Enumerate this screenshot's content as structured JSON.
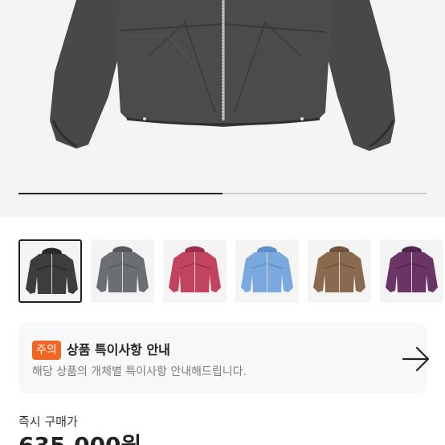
{
  "gallery": {
    "current_index": 0,
    "progress_fraction": 0.5,
    "thumbnails": [
      {
        "name": "charcoal",
        "color": "#3d3d3f",
        "shade": "#2a2a2c"
      },
      {
        "name": "grey",
        "color": "#6b6f73",
        "shade": "#54575b"
      },
      {
        "name": "pink",
        "color": "#c2435e",
        "shade": "#9e2f48"
      },
      {
        "name": "blue",
        "color": "#7aa9e0",
        "shade": "#5d8fcb"
      },
      {
        "name": "brown",
        "color": "#8a6a4e",
        "shade": "#6e523b"
      },
      {
        "name": "purple",
        "color": "#6a3565",
        "shade": "#4e2449"
      }
    ]
  },
  "notice": {
    "badge": "주의",
    "title": "상품 특이사항 안내",
    "subtitle": "해당 상품의 개체별 특이사항 안내해드립니다."
  },
  "price": {
    "label": "즉시 구매가",
    "value": "635,000원"
  },
  "colors": {
    "accent": "#f26522",
    "text": "#222222",
    "muted": "#7a7a7a"
  }
}
